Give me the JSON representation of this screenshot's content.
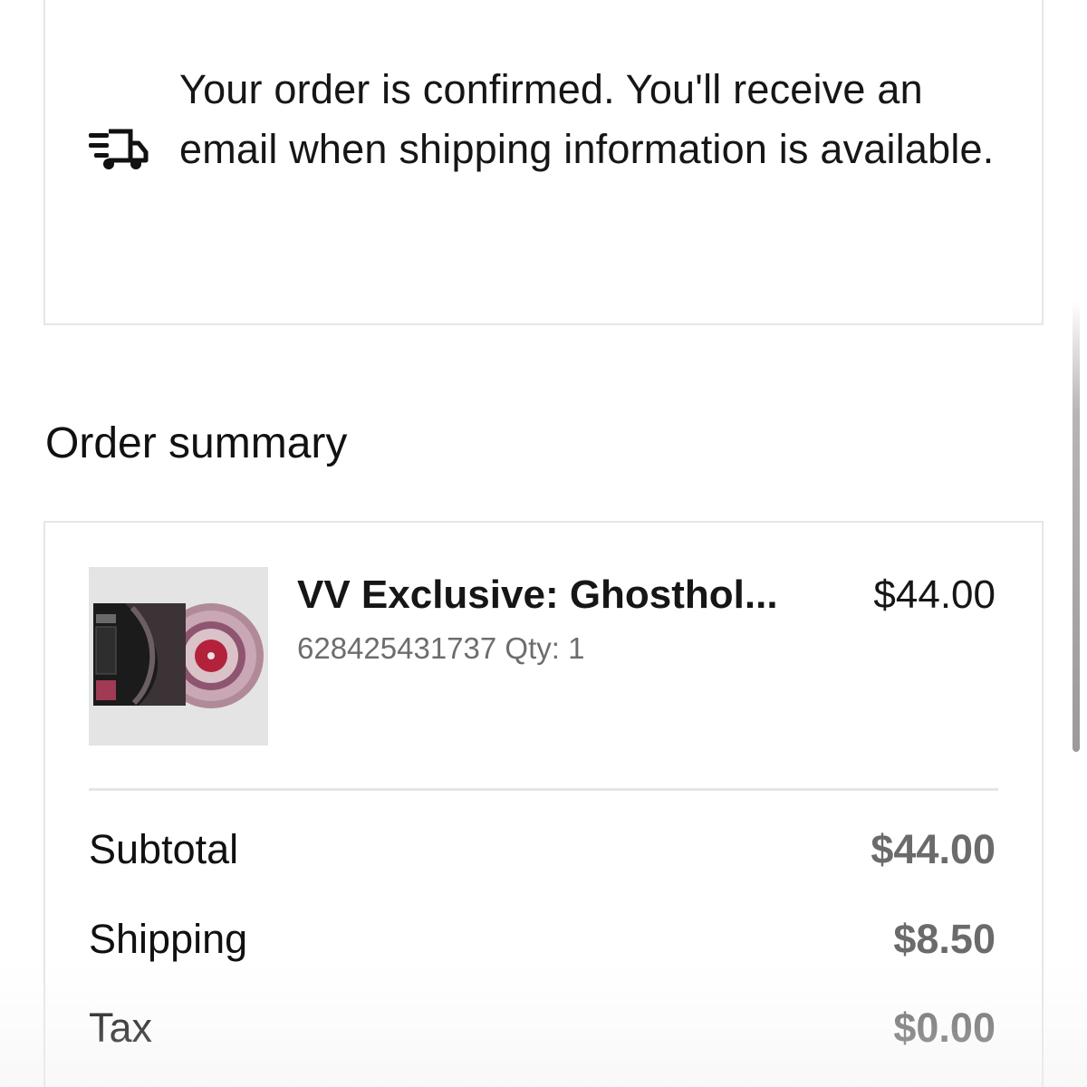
{
  "confirmation": {
    "icon": "truck-icon",
    "message": "Your order is confirmed. You'll receive an email when shipping information is available."
  },
  "order_summary": {
    "title": "Order summary",
    "item": {
      "name": "VV Exclusive: Ghosthol...",
      "sku": "628425431737",
      "qty_label": "Qty: 1",
      "price": "$44.00",
      "thumbnail": "vinyl-record-thumbnail"
    },
    "rows": [
      {
        "label": "Subtotal",
        "value": "$44.00"
      },
      {
        "label": "Shipping",
        "value": "$8.50"
      },
      {
        "label": "Tax",
        "value": "$0.00"
      }
    ]
  },
  "colors": {
    "text": "#111111",
    "muted": "#6b6b6b",
    "border": "#e6e6e6",
    "record_red": "#b3223a",
    "record_pink": "#c9a7b4"
  }
}
